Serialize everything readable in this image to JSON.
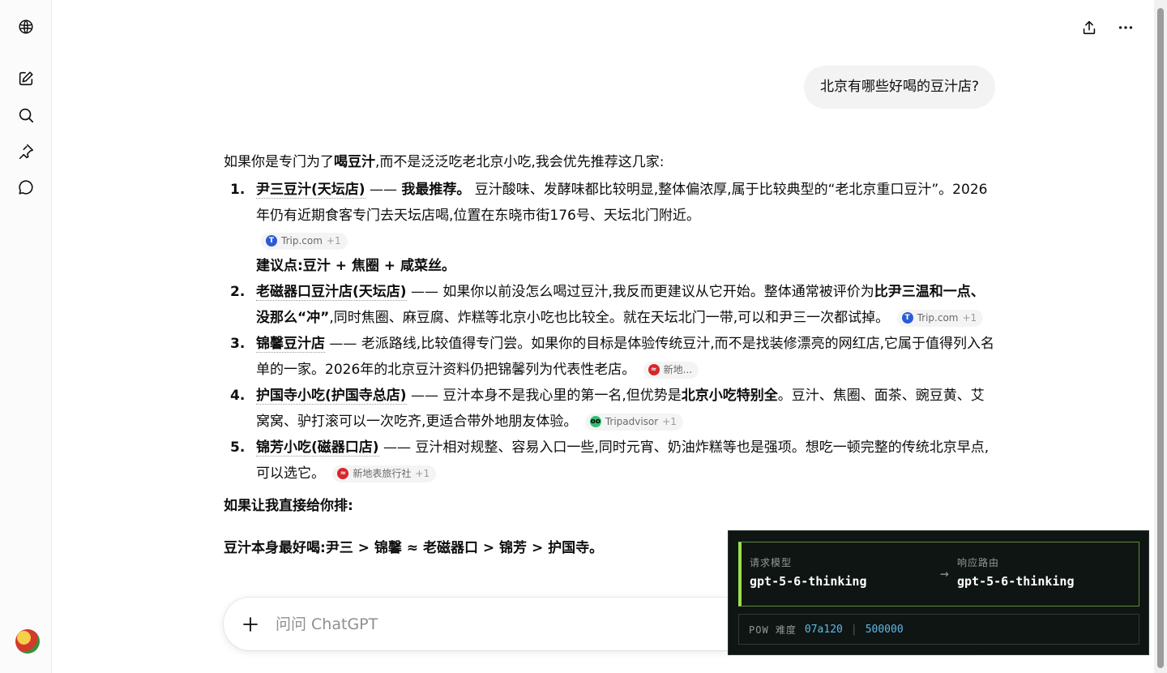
{
  "composer": {
    "placeholder": "问问 ChatGPT"
  },
  "user_message": "北京有哪些好喝的豆汁店?",
  "answer": {
    "intro_a": "如果你是专门为了",
    "intro_b": "喝豆汁",
    "intro_c": ",而不是泛泛吃老北京小吃,我会优先推荐这几家:",
    "items": [
      {
        "num": "1.",
        "name": "尹三豆汁(天坛店)",
        "sep": " —— ",
        "tag": "我最推荐。",
        "text": " 豆汁酸味、发酵味都比较明显,整体偏浓厚,属于比较典型的“老北京重口豆汁”。2026 年仍有近期食客专门去天坛店喝,位置在东晓市街176号、天坛北门附近。",
        "source": "Trip.com",
        "source_more": "+1",
        "sub": "建议点:豆汁 + 焦圈 + 咸菜丝。"
      },
      {
        "num": "2.",
        "name": "老磁器口豆汁店(天坛店)",
        "text_a": " —— 如果你以前没怎么喝过豆汁,我反而更建议从它开始。整体通常被评价为",
        "tag": "比尹三温和一点、没那么“冲”",
        "text_b": ",同时焦圈、麻豆腐、炸糕等北京小吃也比较全。就在天坛北门一带,可以和尹三一次都试掉。",
        "source": "Trip.com",
        "source_more": "+1"
      },
      {
        "num": "3.",
        "name": "锦馨豆汁店",
        "text": " —— 老派路线,比较值得专门尝。如果你的目标是体验传统豆汁,而不是找装修漂亮的网红店,它属于值得列入名单的一家。2026年的北京豆汁资料仍把锦馨列为代表性老店。",
        "source": "新地..."
      },
      {
        "num": "4.",
        "name": "护国寺小吃(护国寺总店)",
        "text_a": " —— 豆汁本身不是我心里的第一名,但优势是",
        "tag": "北京小吃特别全",
        "text_b": "。豆汁、焦圈、面茶、豌豆黄、艾窝窝、驴打滚可以一次吃齐,更适合带外地朋友体验。",
        "source": "Tripadvisor",
        "source_more": "+1"
      },
      {
        "num": "5.",
        "name": "锦芳小吃(磁器口店)",
        "text": " —— 豆汁相对规整、容易入口一些,同时元宵、奶油炸糕等也是强项。想吃一顿完整的传统北京早点,可以选它。",
        "source": "新地表旅行社",
        "source_more": "+1"
      }
    ],
    "rank_heading": "如果让我直接给你排:",
    "rank_line": "豆汁本身最好喝:尹三 > 锦馨 ≈ 老磁器口 > 锦芳 > 护国寺。"
  },
  "overlay": {
    "req_label": "请求模型",
    "req_value": "gpt-5-6-thinking",
    "resp_label": "响应路由",
    "resp_value": "gpt-5-6-thinking",
    "arrow": "→",
    "pow_label": "POW 难度",
    "pow_value1": "07a120",
    "pow_sep": "|",
    "pow_value2": "500000"
  },
  "colors": {
    "accent_green": "#9be04a",
    "pow_blue": "#5fb8e6",
    "overlay_bg": "#0f1513"
  },
  "icons": [
    "openai-logo-icon",
    "new-chat-icon",
    "search-icon",
    "pin-icon",
    "chat-bubble-icon",
    "share-icon",
    "more-icon",
    "plus-icon"
  ]
}
